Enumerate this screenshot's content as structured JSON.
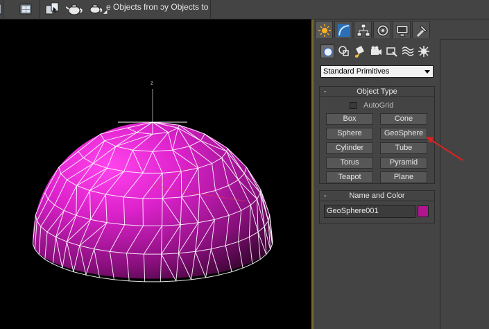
{
  "toolbar": {
    "breadcrumb_text": "e Objects fron ɔy Objects to",
    "icons": [
      "scene-explorer-icon",
      "select-by-name-icon",
      "teapot-render-icon",
      "teapot-render-dropdown-icon"
    ]
  },
  "viewport": {
    "axis_label": "z",
    "object_color": "#cc22bb",
    "wire_color": "#ffffff",
    "annotation_arrow_color": "#e02020"
  },
  "command_panel": {
    "tabs": [
      "create-tab",
      "modify-tab",
      "hierarchy-tab",
      "motion-tab",
      "display-tab",
      "utilities-tab"
    ],
    "subcategories": [
      "geometry",
      "shapes",
      "lights",
      "cameras",
      "helpers",
      "space-warps",
      "systems"
    ],
    "category_dropdown": {
      "selected": "Standard Primitives"
    },
    "object_type": {
      "title": "Object Type",
      "collapse_symbol": "-",
      "autogrid_label": "AutoGrid",
      "buttons": [
        {
          "label": "Box"
        },
        {
          "label": "Cone"
        },
        {
          "label": "Sphere"
        },
        {
          "label": "GeoSphere"
        },
        {
          "label": "Cylinder"
        },
        {
          "label": "Tube"
        },
        {
          "label": "Torus"
        },
        {
          "label": "Pyramid"
        },
        {
          "label": "Teapot"
        },
        {
          "label": "Plane"
        }
      ]
    },
    "name_and_color": {
      "title": "Name and Color",
      "collapse_symbol": "-",
      "name_value": "GeoSphere001",
      "color": "#b0148e"
    }
  }
}
